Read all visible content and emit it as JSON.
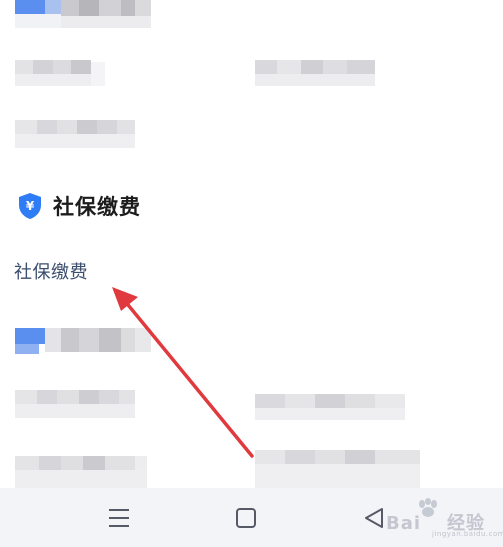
{
  "section": {
    "icon": "shield-yuan-icon",
    "icon_glyph": "¥",
    "title": "社保缴费"
  },
  "links": [
    {
      "label": "社保缴费"
    }
  ],
  "navbar": {
    "menu_icon": "menu-icon",
    "home_icon": "home-square-icon",
    "back_icon": "back-triangle-icon"
  },
  "watermark": {
    "text": "Bai",
    "text2": "经验",
    "sub": "jingyan.baidu.com"
  },
  "colors": {
    "accent_blue": "#2f7df6",
    "link_text": "#3b4e6e",
    "annotation_arrow": "#e0393e",
    "navbar_bg": "#f3f4f8"
  }
}
